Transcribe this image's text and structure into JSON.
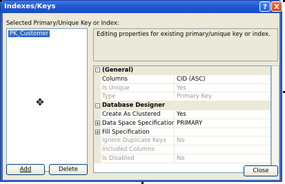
{
  "window": {
    "title": "Indexes/Keys"
  },
  "titlebar_buttons": {
    "help": "?",
    "close": "X"
  },
  "selected_label": "Selected Primary/Unique Key or Index:",
  "list_items": [
    "PK_Customer"
  ],
  "description": "Editing properties for existing primary/unique key or index.",
  "property_grid": {
    "rows": [
      {
        "type": "category",
        "expander": "-",
        "name": "(General)"
      },
      {
        "type": "prop",
        "name": "Columns",
        "value": "CID (ASC)",
        "disabled": false
      },
      {
        "type": "prop",
        "name": "Is Unique",
        "value": "Yes",
        "disabled": true
      },
      {
        "type": "prop",
        "name": "Type",
        "value": "Primary Key",
        "disabled": true
      },
      {
        "type": "category",
        "expander": "-",
        "name": "Database Designer"
      },
      {
        "type": "prop",
        "name": "Create As Clustered",
        "value": "Yes",
        "disabled": false
      },
      {
        "type": "prop",
        "expander": "+",
        "name": "Data Space Specification",
        "value": "PRIMARY",
        "disabled": false
      },
      {
        "type": "prop",
        "expander": "+",
        "name": "Fill Specification",
        "value": "",
        "disabled": false
      },
      {
        "type": "prop",
        "name": "Ignore Duplicate Keys",
        "value": "No",
        "disabled": true
      },
      {
        "type": "prop",
        "name": "Included Columns",
        "value": "",
        "disabled": true
      },
      {
        "type": "prop",
        "name": "Is Disabled",
        "value": "No",
        "disabled": true
      }
    ]
  },
  "buttons": {
    "add": "Add",
    "delete": "Delete",
    "close": "Close"
  },
  "colors": {
    "titlebar": "#1f56d1",
    "selection": "#316ac5",
    "dialog_bg": "#ece9d8"
  }
}
